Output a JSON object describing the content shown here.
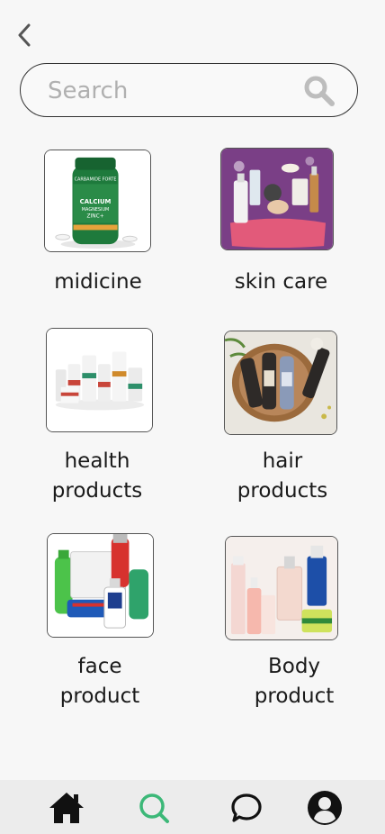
{
  "search": {
    "placeholder": "Search",
    "value": ""
  },
  "categories": [
    {
      "label_line1": "midicine",
      "label_line2": ""
    },
    {
      "label_line1": "skin care",
      "label_line2": ""
    },
    {
      "label_line1": "health",
      "label_line2": "products"
    },
    {
      "label_line1": "hair",
      "label_line2": "products"
    },
    {
      "label_line1": "face",
      "label_line2": "product"
    },
    {
      "label_line1": "Body",
      "label_line2": "product"
    }
  ],
  "product_image_text": {
    "bottle_brand": "CARBAMIDE FORTE",
    "bottle_l1": "CALCIUM",
    "bottle_l2": "MAGNESIUM",
    "bottle_l3": "ZINC+"
  },
  "bottom_nav": {
    "items": [
      "home",
      "search",
      "chat",
      "profile"
    ],
    "active": "search"
  },
  "colors": {
    "accent": "#3cb878",
    "icon": "#111111",
    "nav_bg": "#ececec",
    "page_bg": "#f7f7f7"
  }
}
